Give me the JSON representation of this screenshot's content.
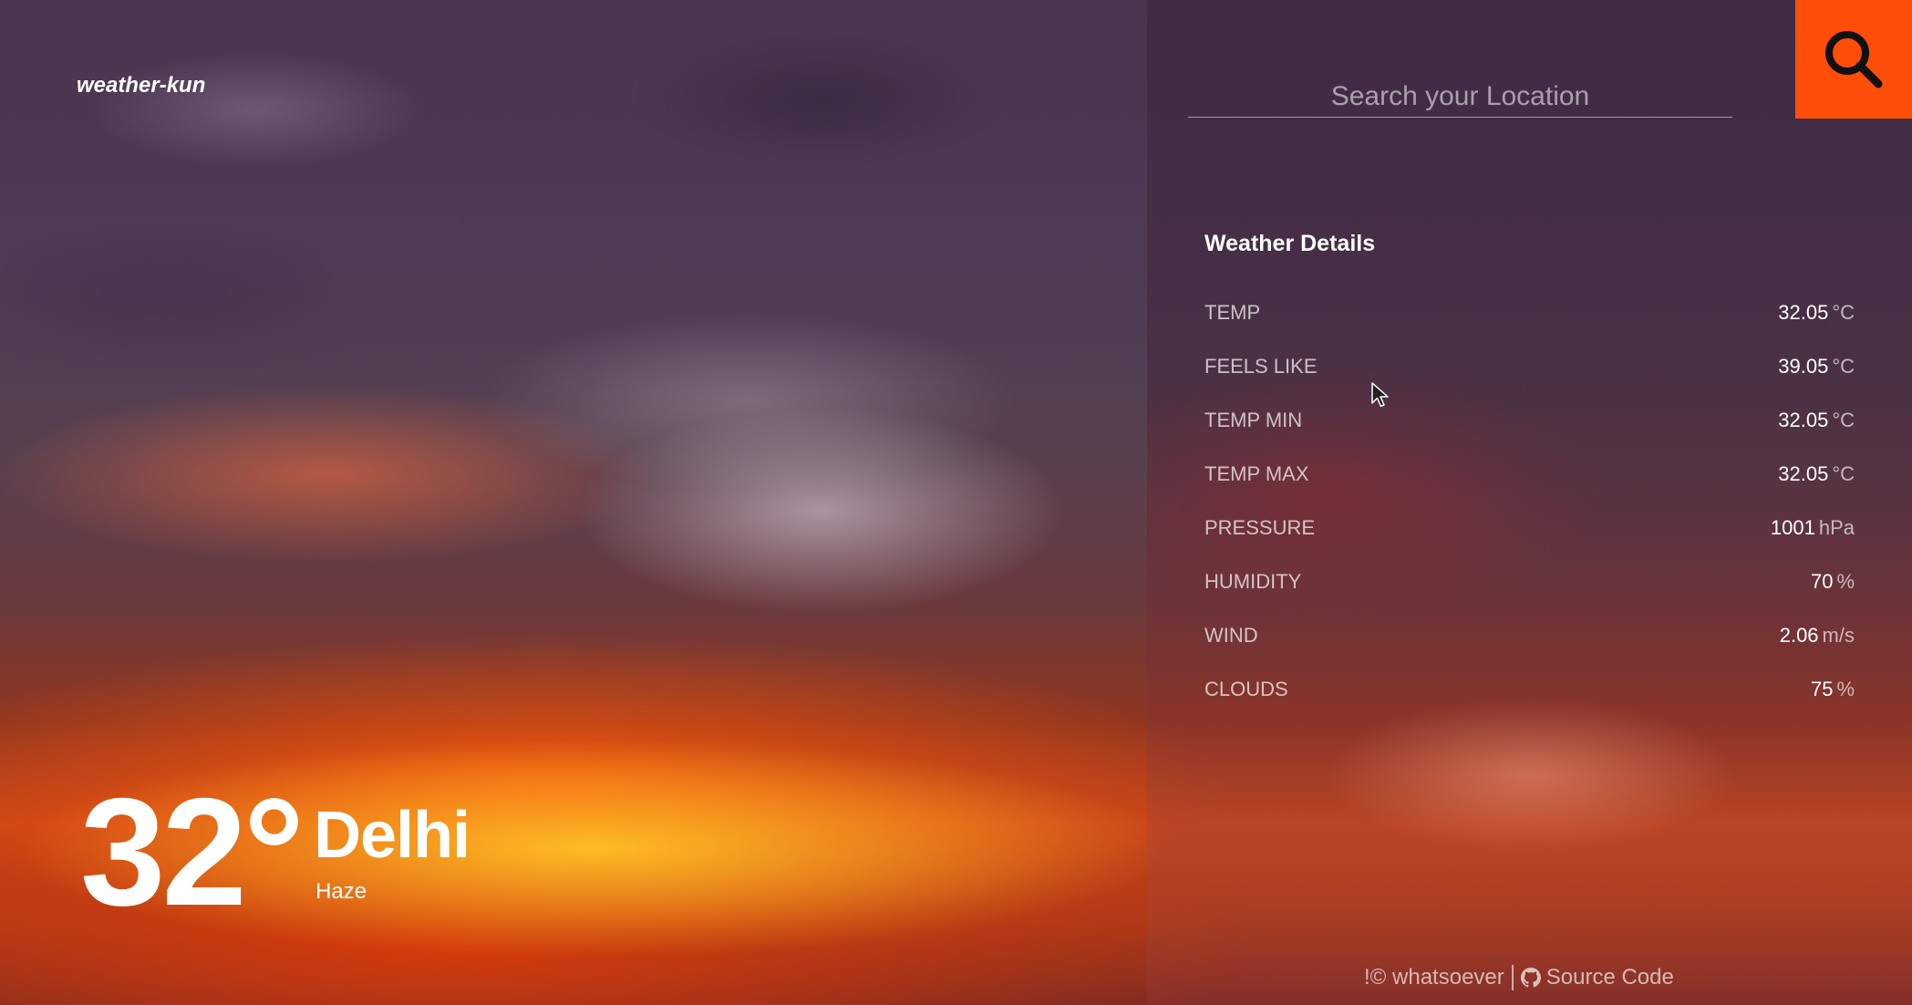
{
  "brand": {
    "name": "weather-kun"
  },
  "current": {
    "temperature": "32°",
    "city": "Delhi",
    "condition": "Haze"
  },
  "search": {
    "placeholder": "Search your Location",
    "value": "",
    "button_icon": "search-icon"
  },
  "details": {
    "title": "Weather Details",
    "rows": [
      {
        "label": "TEMP",
        "value": "32.05",
        "unit": "°C"
      },
      {
        "label": "FEELS LIKE",
        "value": "39.05",
        "unit": "°C"
      },
      {
        "label": "TEMP MIN",
        "value": "32.05",
        "unit": "°C"
      },
      {
        "label": "TEMP MAX",
        "value": "32.05",
        "unit": "°C"
      },
      {
        "label": "PRESSURE",
        "value": "1001",
        "unit": "hPa"
      },
      {
        "label": "HUMIDITY",
        "value": "70",
        "unit": "%"
      },
      {
        "label": "WIND",
        "value": "2.06",
        "unit": "m/s"
      },
      {
        "label": "CLOUDS",
        "value": "75",
        "unit": "%"
      }
    ]
  },
  "footer": {
    "copyright": "!© whatsoever",
    "source_link": "Source Code",
    "source_icon": "github-icon"
  },
  "colors": {
    "accent": "#ff4d0a"
  }
}
